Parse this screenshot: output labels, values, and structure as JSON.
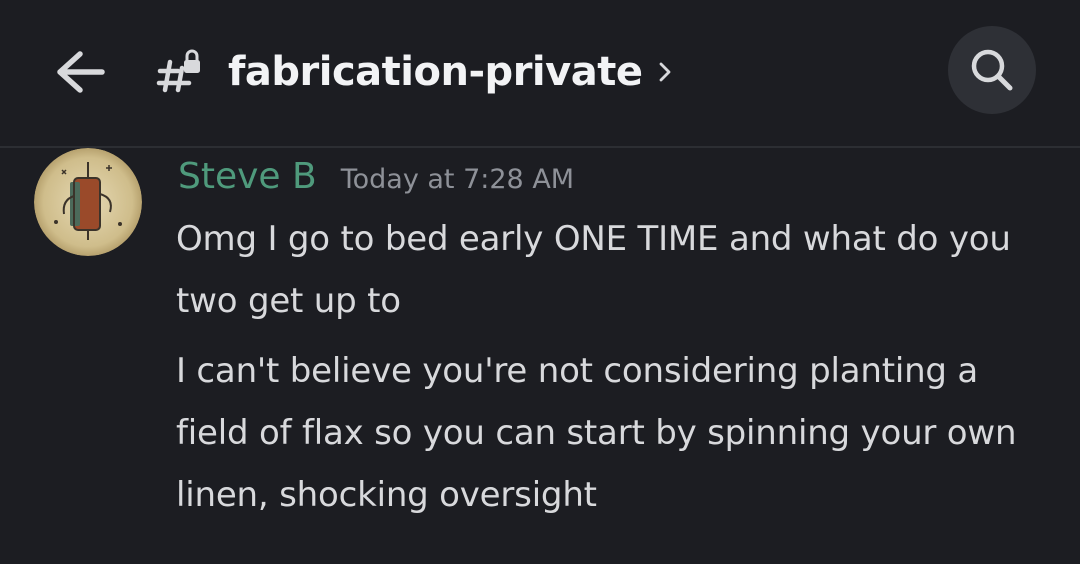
{
  "header": {
    "channel_name": "fabrication-private",
    "back_icon": "arrow-left-icon",
    "channel_icon": "locked-hash-icon",
    "chevron_icon": "chevron-right-icon",
    "search_icon": "search-icon"
  },
  "messages": [
    {
      "author": "Steve B",
      "author_color": "#4f9a7c",
      "timestamp": "Today at 7:28 AM",
      "lines": [
        "Omg I go to bed early ONE TIME and what do you two get up to",
        "I can't believe you're not considering planting a field of flax so you can start by spinning your own linen, shocking oversight"
      ]
    }
  ]
}
